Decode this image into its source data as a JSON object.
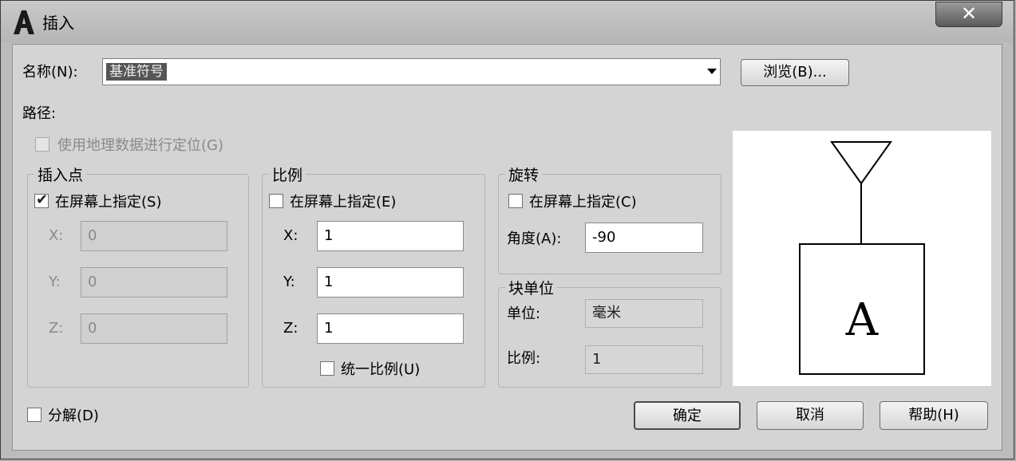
{
  "window": {
    "title": "插入",
    "close_label": "✕"
  },
  "name_row": {
    "label": "名称(N):",
    "value": "基准符号",
    "browse_label": "浏览(B)..."
  },
  "path": {
    "label": "路径:"
  },
  "geo_checkbox": {
    "label": "使用地理数据进行定位(G)",
    "checked": false,
    "enabled": false
  },
  "insertion_point": {
    "title": "插入点",
    "specify_label": "在屏幕上指定(S)",
    "specify_checked": true,
    "x_label": "X:",
    "x_value": "0",
    "y_label": "Y:",
    "y_value": "0",
    "z_label": "Z:",
    "z_value": "0"
  },
  "scale": {
    "title": "比例",
    "specify_label": "在屏幕上指定(E)",
    "specify_checked": false,
    "x_label": "X:",
    "x_value": "1",
    "y_label": "Y:",
    "y_value": "1",
    "z_label": "Z:",
    "z_value": "1",
    "uniform_label": "统一比例(U)",
    "uniform_checked": false
  },
  "rotation": {
    "title": "旋转",
    "specify_label": "在屏幕上指定(C)",
    "specify_checked": false,
    "angle_label": "角度(A):",
    "angle_value": "-90"
  },
  "block_unit": {
    "title": "块单位",
    "unit_label": "单位:",
    "unit_value": "毫米",
    "factor_label": "比例:",
    "factor_value": "1"
  },
  "explode": {
    "label": "分解(D)",
    "checked": false
  },
  "buttons": {
    "ok": "确定",
    "cancel": "取消",
    "help": "帮助(H)"
  },
  "preview": {
    "block_letter": "A"
  }
}
